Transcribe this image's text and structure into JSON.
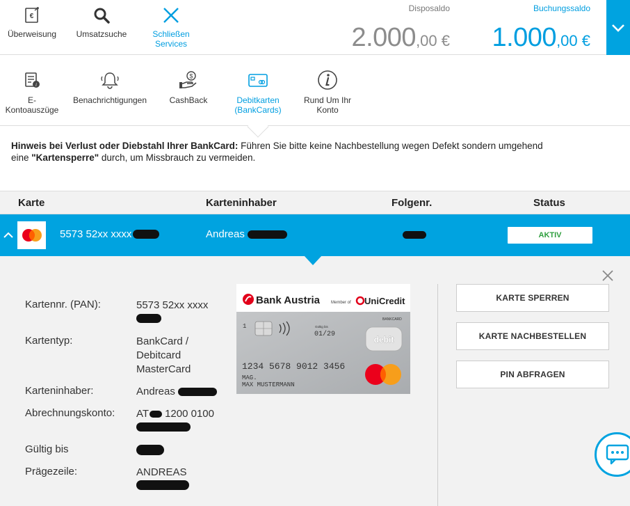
{
  "top_nav": {
    "transfer": "Überweisung",
    "search": "Umsatzsuche",
    "close_line1": "Schließen",
    "close_line2": "Services"
  },
  "balances": {
    "dispo_label": "Disposaldo",
    "dispo_int": "2.000",
    "dispo_dec": ",00 €",
    "booking_label": "Buchungssaldo",
    "booking_int": "1.000",
    "booking_dec": ",00 €"
  },
  "sub_nav": {
    "estatements_line1": "E-",
    "estatements_line2": "Kontoauszüge",
    "notifications": "Benachrichtigungen",
    "cashback": "CashBack",
    "debitcards_line1": "Debitkarten",
    "debitcards_line2": "(BankCards)",
    "about_line1": "Rund Um Ihr",
    "about_line2": "Konto"
  },
  "notice": {
    "bold1": "Hinweis bei Verlust oder Diebstahl Ihrer BankCard:",
    "text1": " Führen Sie bitte keine Nachbestellung wegen Defekt sondern umgehend",
    "text2": "eine ",
    "bold2": "\"Kartensperre\"",
    "text3": " durch, um Missbrauch zu vermeiden."
  },
  "table": {
    "headers": {
      "card": "Karte",
      "holder": "Karteninhaber",
      "seq": "Folgenr.",
      "status": "Status"
    },
    "row": {
      "pan": "5573 52xx xxxx",
      "holder": "Andreas",
      "status": "AKTIV"
    }
  },
  "detail": {
    "labels": {
      "pan": "Kartennr. (PAN):",
      "type": "Kartentyp:",
      "holder": "Karteninhaber:",
      "account": "Abrechnungskonto:",
      "valid": "Gültig bis",
      "emboss": "Prägezeile:"
    },
    "values": {
      "pan": "5573 52xx xxxx",
      "type_line1": "BankCard /",
      "type_line2": "Debitcard",
      "type_line3": "MasterCard",
      "holder": "Andreas",
      "account_prefix": "AT",
      "account_rest": "1200 0100",
      "emboss": "ANDREAS"
    }
  },
  "card_visual": {
    "bank": "Bank Austria",
    "member_of": "Member of",
    "unicredit": "UniCredit",
    "bankcard": "BANKCARD",
    "debit": "debit",
    "index": "1",
    "valid_label": "Gültig bis",
    "valid": "01/29",
    "number": "1234  5678  9012  3456",
    "title": "MAG.",
    "name": "MAX MUSTERMANN"
  },
  "actions": {
    "block": "KARTE SPERREN",
    "reorder": "KARTE NACHBESTELLEN",
    "pin": "PIN ABFRAGEN"
  },
  "colors": {
    "accent": "#00a3e0",
    "status_green": "#2e9e3e",
    "panel_bg": "#f2f2f2",
    "unicredit_red": "#e2001a"
  }
}
